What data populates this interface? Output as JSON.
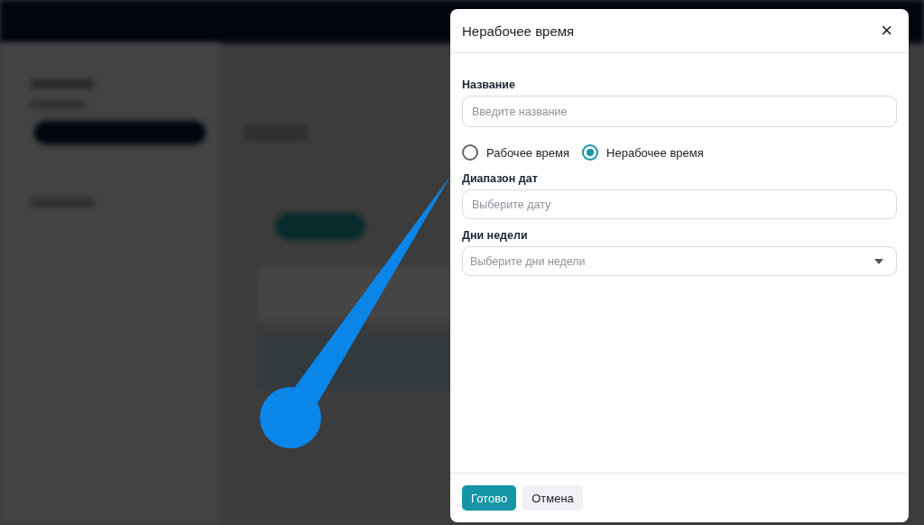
{
  "dialog": {
    "title": "Нерабочее время",
    "close": "×",
    "name_field": {
      "label": "Название",
      "placeholder": "Введите название"
    },
    "time_type": [
      {
        "label": "Рабочее время",
        "selected": false
      },
      {
        "label": "Нерабочее время",
        "selected": true
      }
    ],
    "date_range": {
      "label": "Диапазон дат",
      "placeholder": "Выберите дату"
    },
    "weekdays": {
      "label": "Дни недели",
      "placeholder": "Выберите дни недели"
    },
    "buttons": [
      {
        "label": "Готово",
        "kind": "primary"
      },
      {
        "label": "Отмена",
        "kind": "secondary"
      }
    ]
  }
}
